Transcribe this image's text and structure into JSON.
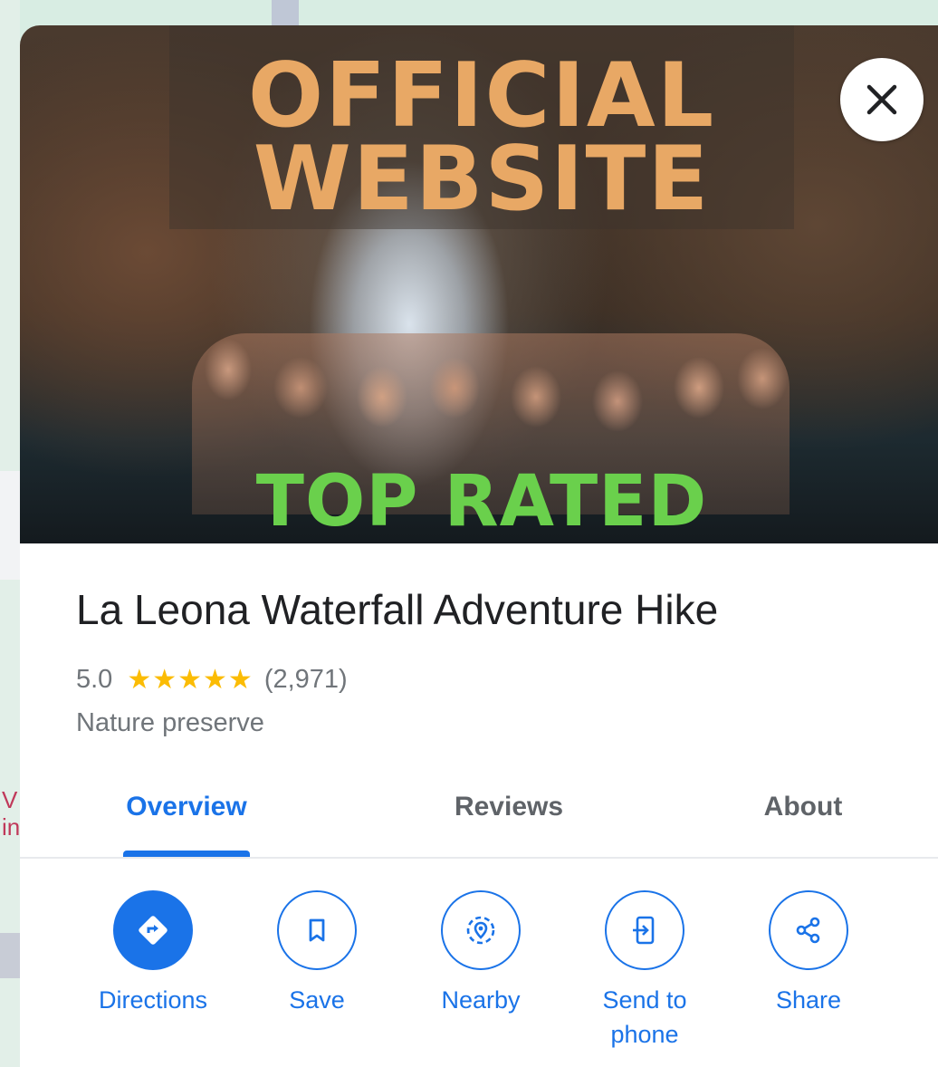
{
  "map": {
    "edge_label": "V\nin"
  },
  "hero": {
    "headline_line1": "OFFICIAL",
    "headline_line2": "WEBSITE",
    "badge": "TOP RATED",
    "headline_color": "#e8a865",
    "badge_color": "#6ad04c"
  },
  "close_button": {
    "icon": "close-icon"
  },
  "place": {
    "title": "La Leona Waterfall Adventure Hike",
    "rating": "5.0",
    "stars": "★★★★★",
    "star_fraction": 1.0,
    "review_count": "(2,971)",
    "category": "Nature preserve"
  },
  "tabs": [
    {
      "label": "Overview",
      "active": true
    },
    {
      "label": "Reviews",
      "active": false
    },
    {
      "label": "About",
      "active": false
    }
  ],
  "actions": [
    {
      "label": "Directions",
      "icon": "directions-icon"
    },
    {
      "label": "Save",
      "icon": "bookmark-icon"
    },
    {
      "label": "Nearby",
      "icon": "nearby-icon"
    },
    {
      "label": "Send to\nphone",
      "icon": "send-to-phone-icon"
    },
    {
      "label": "Share",
      "icon": "share-icon"
    }
  ],
  "colors": {
    "accent": "#1a73e8",
    "star": "#fbbc04"
  }
}
